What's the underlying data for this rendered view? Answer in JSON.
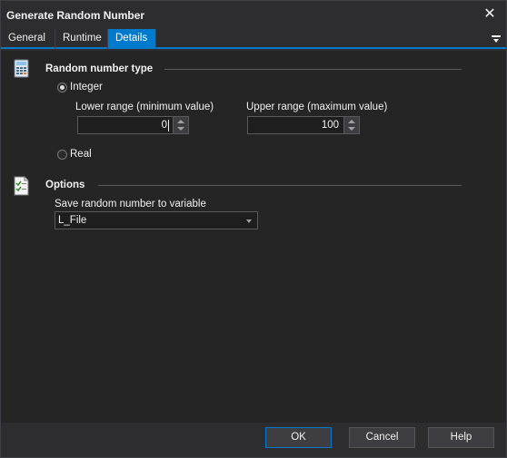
{
  "window": {
    "title": "Generate Random Number"
  },
  "tabs": [
    {
      "label": "General"
    },
    {
      "label": "Runtime"
    },
    {
      "label": "Details"
    }
  ],
  "random_type": {
    "heading": "Random number type",
    "integer_label": "Integer",
    "integer_selected": true,
    "lower_label": "Lower range (minimum value)",
    "lower_value": "0",
    "upper_label": "Upper range (maximum value)",
    "upper_value": "100",
    "real_label": "Real",
    "real_selected": false
  },
  "options": {
    "heading": "Options",
    "save_label": "Save random number to variable",
    "variable_value": "L_File"
  },
  "buttons": {
    "ok": "OK",
    "cancel": "Cancel",
    "help": "Help"
  },
  "colors": {
    "accent": "#007acc",
    "background": "#252526",
    "chrome": "#2d2d30"
  }
}
